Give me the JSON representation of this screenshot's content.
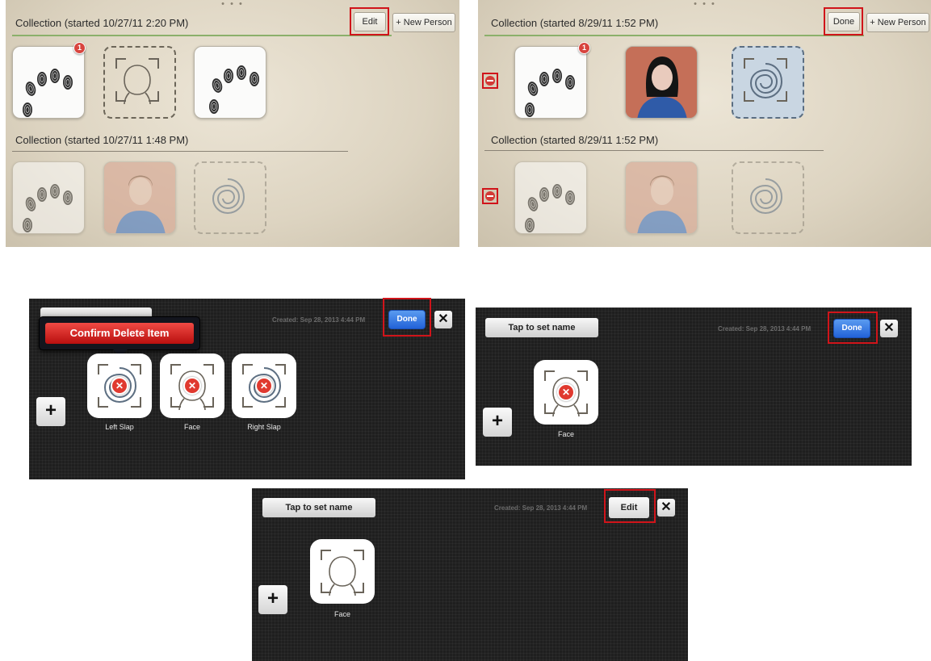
{
  "colors": {
    "highlight": "#d0141a",
    "done_blue": "#2262d8",
    "delete_red": "#e0392f",
    "collection_underline": "#8bb06b"
  },
  "top_left": {
    "window_dots": "• • •",
    "collection_1": {
      "title": "Collection (started 10/27/11 2:20 PM)",
      "badge": "1"
    },
    "edit_button": "Edit",
    "new_person_button": "+ New Person",
    "collection_2": {
      "title": "Collection (started 10/27/11 1:48 PM)"
    },
    "icons": [
      "fingerprint-slap-icon",
      "face-placeholder-icon",
      "fingerprint-slap-icon",
      "fingerprint-slap-icon",
      "face-photo",
      "fingerprint-swirl-icon"
    ]
  },
  "top_right": {
    "window_dots": "• • •",
    "collection_1": {
      "title": "Collection (started 8/29/11 1:52 PM)",
      "badge": "1"
    },
    "done_button": "Done",
    "new_person_button": "+ New Person",
    "collection_2": {
      "title": "Collection (started 8/29/11 1:52 PM)"
    },
    "icons": [
      "delete-minus-icon",
      "fingerprint-slap-icon",
      "face-photo",
      "fingerprint-swirl-icon"
    ]
  },
  "mobile_1": {
    "created": "Created: Sep 28, 2013 4:44 PM",
    "done_button": "Done",
    "close_button": "✕",
    "confirm_delete": "Confirm Delete Item",
    "add_button": "+",
    "items": [
      {
        "label": "Left Slap",
        "icon": "slap-delete-icon"
      },
      {
        "label": "Face",
        "icon": "face-delete-icon"
      },
      {
        "label": "Right Slap",
        "icon": "slap-delete-icon"
      }
    ],
    "delete_mark": "✕"
  },
  "mobile_2": {
    "name_button": "Tap to set name",
    "created": "Created: Sep 28, 2013 4:44 PM",
    "done_button": "Done",
    "close_button": "✕",
    "add_button": "+",
    "items": [
      {
        "label": "Face",
        "icon": "face-delete-icon"
      }
    ],
    "delete_mark": "✕"
  },
  "mobile_3": {
    "name_button": "Tap to set name",
    "created": "Created: Sep 28, 2013 4:44 PM",
    "edit_button": "Edit",
    "close_button": "✕",
    "add_button": "+",
    "items": [
      {
        "label": "Face",
        "icon": "face-icon"
      }
    ]
  }
}
